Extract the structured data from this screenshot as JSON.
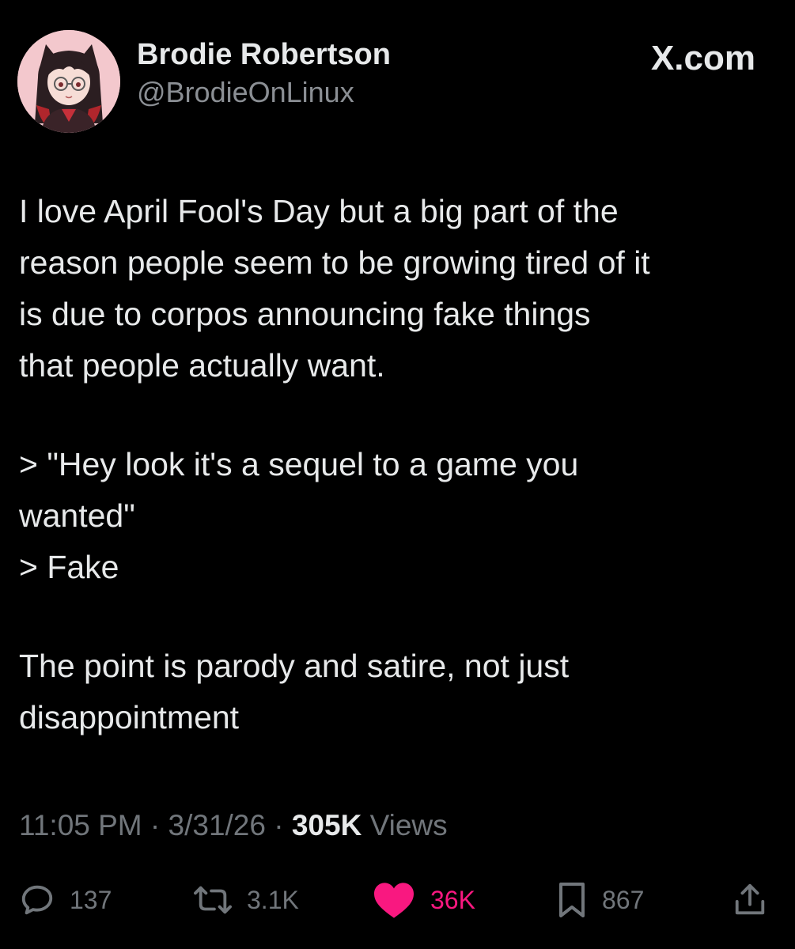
{
  "brand": {
    "label": "X.com"
  },
  "author": {
    "display_name": "Brodie Robertson",
    "handle": "@BrodieOnLinux",
    "avatar_icon": "anime-avatar"
  },
  "tweet": {
    "paragraphs": [
      [
        "I love April Fool's Day but a big part of the",
        "reason people seem to be growing tired of it",
        "is due to corpos announcing fake things",
        "that people actually want."
      ],
      [
        "> \"Hey look it's a sequel to a game you",
        "wanted\"",
        "> Fake"
      ],
      [
        "The point is parody and satire, not just",
        "disappointment"
      ]
    ]
  },
  "meta": {
    "time": "11:05 PM",
    "separator": "·",
    "date": "3/31/26",
    "views_count": "305K",
    "views_label": "Views"
  },
  "actions": {
    "replies": {
      "icon": "reply-icon",
      "count": "137"
    },
    "reposts": {
      "icon": "repost-icon",
      "count": "3.1K"
    },
    "likes": {
      "icon": "heart-icon",
      "count": "36K",
      "liked": true
    },
    "bookmarks": {
      "icon": "bookmark-icon",
      "count": "867"
    },
    "share": {
      "icon": "share-icon"
    }
  },
  "colors": {
    "background": "#000000",
    "text_primary": "#e7e9ea",
    "text_secondary": "#71767b",
    "like_active": "#f91880"
  }
}
